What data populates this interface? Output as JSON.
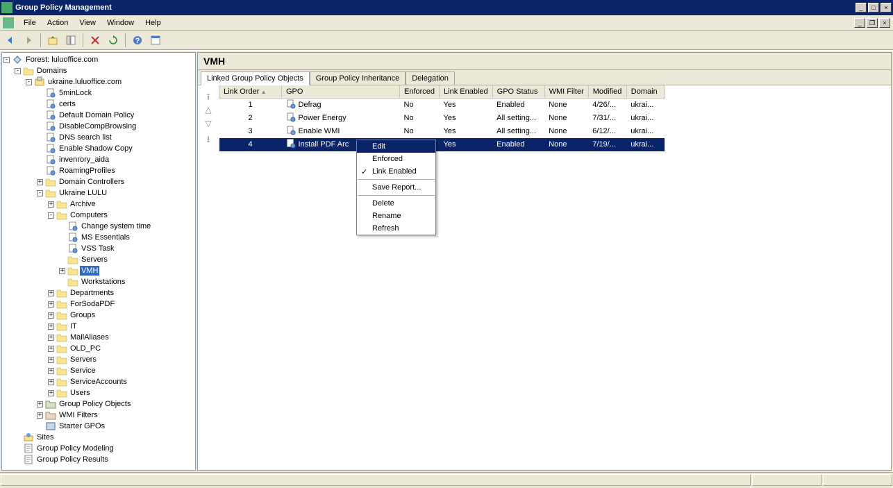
{
  "window": {
    "title": "Group Policy Management"
  },
  "menus": [
    "File",
    "Action",
    "View",
    "Window",
    "Help"
  ],
  "tree": [
    {
      "d": 0,
      "t": "-",
      "i": "gpm",
      "l": "Forest: luluoffice.com"
    },
    {
      "d": 1,
      "t": "-",
      "i": "folder",
      "l": "Domains"
    },
    {
      "d": 2,
      "t": "-",
      "i": "domain",
      "l": "ukraine.luluoffice.com"
    },
    {
      "d": 3,
      "t": "",
      "i": "gpolink",
      "l": "5minLock"
    },
    {
      "d": 3,
      "t": "",
      "i": "gpolink",
      "l": "certs"
    },
    {
      "d": 3,
      "t": "",
      "i": "gpolink",
      "l": "Default Domain Policy"
    },
    {
      "d": 3,
      "t": "",
      "i": "gpolink",
      "l": "DisableCompBrowsing"
    },
    {
      "d": 3,
      "t": "",
      "i": "gpolink",
      "l": "DNS search list"
    },
    {
      "d": 3,
      "t": "",
      "i": "gpolink",
      "l": "Enable Shadow Copy"
    },
    {
      "d": 3,
      "t": "",
      "i": "gpolink",
      "l": "invenrory_aida"
    },
    {
      "d": 3,
      "t": "",
      "i": "gpolink",
      "l": "RoamingProfiles"
    },
    {
      "d": 3,
      "t": "+",
      "i": "ou",
      "l": "Domain Controllers"
    },
    {
      "d": 3,
      "t": "-",
      "i": "ou",
      "l": "Ukraine LULU"
    },
    {
      "d": 4,
      "t": "+",
      "i": "ou",
      "l": "Archive"
    },
    {
      "d": 4,
      "t": "-",
      "i": "ou",
      "l": "Computers"
    },
    {
      "d": 5,
      "t": "",
      "i": "gpolink",
      "l": "Change system time"
    },
    {
      "d": 5,
      "t": "",
      "i": "gpolink",
      "l": "MS Essentials"
    },
    {
      "d": 5,
      "t": "",
      "i": "gpolink",
      "l": "VSS Task"
    },
    {
      "d": 5,
      "t": "",
      "i": "ou",
      "l": "Servers"
    },
    {
      "d": 5,
      "t": "+",
      "i": "ou",
      "l": "VMH",
      "sel": true
    },
    {
      "d": 5,
      "t": "",
      "i": "ou",
      "l": "Workstations"
    },
    {
      "d": 4,
      "t": "+",
      "i": "ou",
      "l": "Departments"
    },
    {
      "d": 4,
      "t": "+",
      "i": "ou",
      "l": "ForSodaPDF"
    },
    {
      "d": 4,
      "t": "+",
      "i": "ou",
      "l": "Groups"
    },
    {
      "d": 4,
      "t": "+",
      "i": "ou",
      "l": "IT"
    },
    {
      "d": 4,
      "t": "+",
      "i": "ou",
      "l": "MailAliases"
    },
    {
      "d": 4,
      "t": "+",
      "i": "ou",
      "l": "OLD_PC"
    },
    {
      "d": 4,
      "t": "+",
      "i": "ou",
      "l": "Servers"
    },
    {
      "d": 4,
      "t": "+",
      "i": "ou",
      "l": "Service"
    },
    {
      "d": 4,
      "t": "+",
      "i": "ou",
      "l": "ServiceAccounts"
    },
    {
      "d": 4,
      "t": "+",
      "i": "ou",
      "l": "Users"
    },
    {
      "d": 3,
      "t": "+",
      "i": "gpofolder",
      "l": "Group Policy Objects"
    },
    {
      "d": 3,
      "t": "+",
      "i": "wmifolder",
      "l": "WMI Filters"
    },
    {
      "d": 3,
      "t": "",
      "i": "starter",
      "l": "Starter GPOs"
    },
    {
      "d": 1,
      "t": "",
      "i": "sites",
      "l": "Sites"
    },
    {
      "d": 1,
      "t": "",
      "i": "modeling",
      "l": "Group Policy Modeling"
    },
    {
      "d": 1,
      "t": "",
      "i": "results",
      "l": "Group Policy Results"
    }
  ],
  "content": {
    "title": "VMH",
    "tabs": [
      "Linked Group Policy Objects",
      "Group Policy Inheritance",
      "Delegation"
    ],
    "activeTab": 0,
    "columns": [
      "Link Order",
      "GPO",
      "Enforced",
      "Link Enabled",
      "GPO Status",
      "WMI Filter",
      "Modified",
      "Domain"
    ],
    "rows": [
      {
        "order": "1",
        "gpo": "Defrag",
        "enf": "No",
        "le": "Yes",
        "st": "Enabled",
        "wmi": "None",
        "mod": "4/26/...",
        "dom": "ukrai..."
      },
      {
        "order": "2",
        "gpo": "Power Energy",
        "enf": "No",
        "le": "Yes",
        "st": "All setting...",
        "wmi": "None",
        "mod": "7/31/...",
        "dom": "ukrai..."
      },
      {
        "order": "3",
        "gpo": "Enable WMI",
        "enf": "No",
        "le": "Yes",
        "st": "All setting...",
        "wmi": "None",
        "mod": "6/12/...",
        "dom": "ukrai..."
      },
      {
        "order": "4",
        "gpo": "Install PDF Arc",
        "enf": "",
        "le": "Yes",
        "st": "Enabled",
        "wmi": "None",
        "mod": "7/19/...",
        "dom": "ukrai...",
        "sel": true
      }
    ]
  },
  "contextMenu": {
    "items": [
      {
        "l": "Edit",
        "hl": true
      },
      {
        "l": "Enforced"
      },
      {
        "l": "Link Enabled",
        "chk": true
      },
      {
        "sep": true
      },
      {
        "l": "Save Report..."
      },
      {
        "sep": true
      },
      {
        "l": "Delete"
      },
      {
        "l": "Rename"
      },
      {
        "l": "Refresh"
      }
    ]
  }
}
